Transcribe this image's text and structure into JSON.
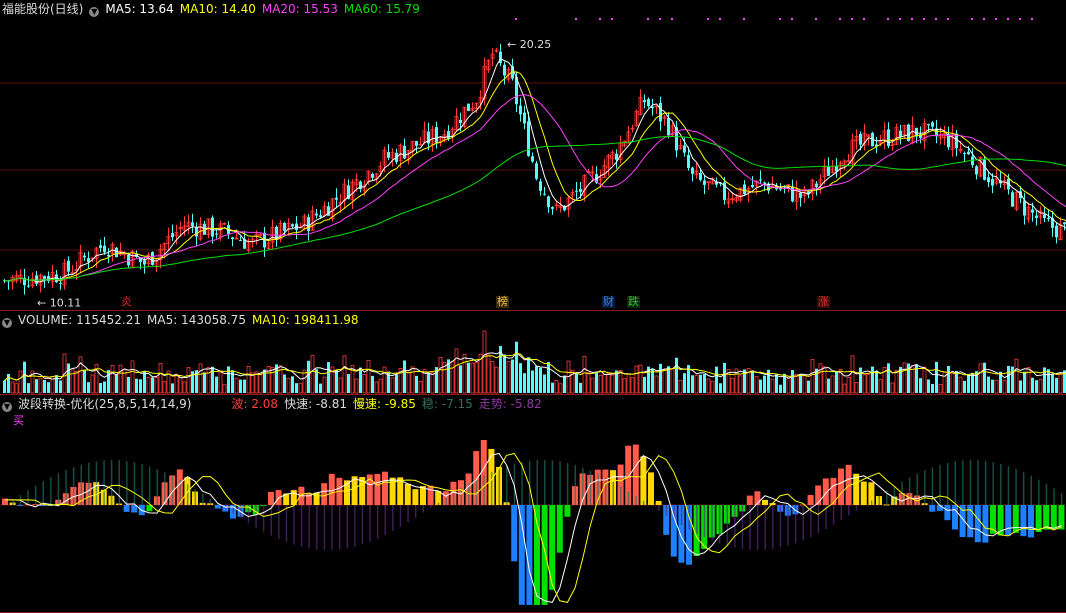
{
  "price_header": {
    "stock": "福能股份(日线)",
    "ma5": "MA5: 13.64",
    "ma10": "MA10: 14.40",
    "ma20": "MA20: 15.53",
    "ma60": "MA60: 15.79"
  },
  "volume_header": {
    "volume": "VOLUME: 115452.21",
    "ma5": "MA5: 143058.75",
    "ma10": "MA10: 198411.98"
  },
  "osc_header": {
    "name": "波段转换-优化(25,8,5,14,14,9)",
    "wave": "波: 2.08",
    "fast": "快速: -8.81",
    "slow": "慢速: -9.85",
    "stable": "稳: -7.15",
    "trend": "走势: -5.82"
  },
  "buy_mark": "买",
  "price_markers": [
    {
      "label": "炎",
      "color": "#e03030"
    },
    {
      "label": "榜",
      "color": "#e8c040"
    },
    {
      "label": "财",
      "color": "#4080ff"
    },
    {
      "label": "跌",
      "color": "#30c030"
    },
    {
      "label": "涨",
      "color": "#e03030"
    }
  ],
  "colors": {
    "up": "#ff3b3b",
    "down": "#54fcfc",
    "ma5": "#ffffff",
    "ma10": "#ffff00",
    "ma20": "#ff40ff",
    "ma60": "#00e000",
    "osc_red": "#ff5a4a",
    "osc_yellow": "#ffd800",
    "osc_blue": "#1e7fff",
    "osc_green": "#00e000",
    "osc_purple": "#5a2a7a",
    "osc_teal": "#1f6f5f"
  },
  "chart_data": [
    {
      "type": "candlestick",
      "title": "福能股份(日线)",
      "ylim": [
        9.5,
        21.0
      ],
      "annotations": [
        {
          "label": "20.25",
          "kind": "high"
        },
        {
          "label": "10.11",
          "kind": "low"
        }
      ],
      "series": [
        {
          "name": "MA5",
          "value": 13.64
        },
        {
          "name": "MA10",
          "value": 14.4
        },
        {
          "name": "MA20",
          "value": 15.53
        },
        {
          "name": "MA60",
          "value": 15.79
        }
      ]
    },
    {
      "type": "bar",
      "title": "VOLUME",
      "series": [
        {
          "name": "VOLUME",
          "value": 115452.21
        },
        {
          "name": "MA5",
          "value": 143058.75
        },
        {
          "name": "MA10",
          "value": 198411.98
        }
      ]
    },
    {
      "type": "bar",
      "title": "波段转换-优化(25,8,5,14,14,9)",
      "series": [
        {
          "name": "波",
          "value": 2.08
        },
        {
          "name": "快速",
          "value": -8.81
        },
        {
          "name": "慢速",
          "value": -9.85
        },
        {
          "name": "稳",
          "value": -7.15
        },
        {
          "name": "走势",
          "value": -5.82
        }
      ]
    }
  ]
}
